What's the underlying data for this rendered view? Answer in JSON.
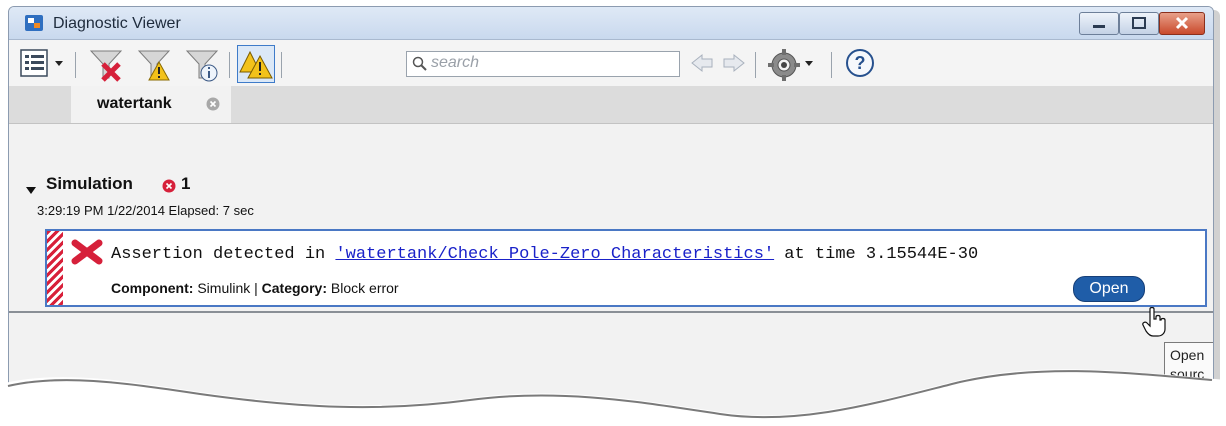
{
  "window": {
    "title": "Diagnostic Viewer"
  },
  "toolbar": {
    "search_placeholder": "search",
    "icons": [
      "list-view-icon",
      "dropdown-arrow-icon",
      "filter-errors-icon",
      "filter-warnings-icon",
      "filter-info-icon",
      "group-warnings-icon",
      "search-icon",
      "back-arrow-icon",
      "forward-arrow-icon",
      "settings-gear-icon",
      "help-icon"
    ]
  },
  "tabs": [
    {
      "label": "watertank"
    }
  ],
  "section": {
    "title": "Simulation",
    "error_count": "1",
    "timestamp": "3:29:19 PM 1/22/2014  Elapsed: 7 sec"
  },
  "message": {
    "text_prefix": "Assertion detected in ",
    "link": "'watertank/Check Pole-Zero Characteristics'",
    "text_suffix": " at time 3.15544E-30",
    "component_label": "Component:",
    "component_value": " Simulink | ",
    "category_label": "Category:",
    "category_value": " Block error",
    "open_button": "Open"
  },
  "tooltip": {
    "line1": "Open",
    "line2": "sourc"
  },
  "colors": {
    "accent": "#1f5da8",
    "error": "#d8203a",
    "link": "#1a22c9"
  }
}
